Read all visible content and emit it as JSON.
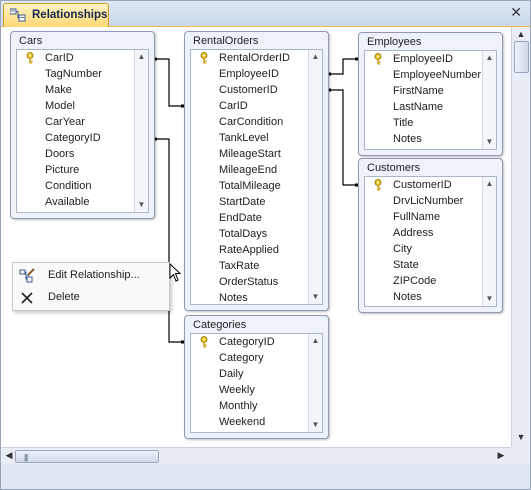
{
  "tab": {
    "title": "Relationships",
    "close_glyph": "✕"
  },
  "tables": [
    {
      "title": "Cars",
      "fields": [
        {
          "name": "CarID",
          "key": true
        },
        {
          "name": "TagNumber"
        },
        {
          "name": "Make"
        },
        {
          "name": "Model"
        },
        {
          "name": "CarYear"
        },
        {
          "name": "CategoryID"
        },
        {
          "name": "Doors"
        },
        {
          "name": "Picture"
        },
        {
          "name": "Condition"
        },
        {
          "name": "Available"
        }
      ]
    },
    {
      "title": "RentalOrders",
      "fields": [
        {
          "name": "RentalOrderID",
          "key": true
        },
        {
          "name": "EmployeeID"
        },
        {
          "name": "CustomerID"
        },
        {
          "name": "CarID"
        },
        {
          "name": "CarCondition"
        },
        {
          "name": "TankLevel"
        },
        {
          "name": "MileageStart"
        },
        {
          "name": "MileageEnd"
        },
        {
          "name": "TotalMileage"
        },
        {
          "name": "StartDate"
        },
        {
          "name": "EndDate"
        },
        {
          "name": "TotalDays"
        },
        {
          "name": "RateApplied"
        },
        {
          "name": "TaxRate"
        },
        {
          "name": "OrderStatus"
        },
        {
          "name": "Notes"
        }
      ]
    },
    {
      "title": "Employees",
      "fields": [
        {
          "name": "EmployeeID",
          "key": true
        },
        {
          "name": "EmployeeNumber"
        },
        {
          "name": "FirstName"
        },
        {
          "name": "LastName"
        },
        {
          "name": "Title"
        },
        {
          "name": "Notes"
        }
      ]
    },
    {
      "title": "Customers",
      "fields": [
        {
          "name": "CustomerID",
          "key": true
        },
        {
          "name": "DrvLicNumber"
        },
        {
          "name": "FullName"
        },
        {
          "name": "Address"
        },
        {
          "name": "City"
        },
        {
          "name": "State"
        },
        {
          "name": "ZIPCode"
        },
        {
          "name": "Notes"
        }
      ]
    },
    {
      "title": "Categories",
      "fields": [
        {
          "name": "CategoryID",
          "key": true
        },
        {
          "name": "Category"
        },
        {
          "name": "Daily"
        },
        {
          "name": "Weekly"
        },
        {
          "name": "Monthly"
        },
        {
          "name": "Weekend"
        }
      ]
    }
  ],
  "context_menu": {
    "items": [
      {
        "label": "Edit Relationship...",
        "icon": "edit-relationship-icon"
      },
      {
        "label": "Delete",
        "icon": "delete-x-icon"
      }
    ]
  },
  "scroll": {
    "up": "▲",
    "down": "▼",
    "left": "◀",
    "right": "▶",
    "grip": "|||"
  },
  "colors": {
    "tab_active": "#ffd773",
    "table_bg": "#eef3fb",
    "border": "#8f9ab0"
  }
}
